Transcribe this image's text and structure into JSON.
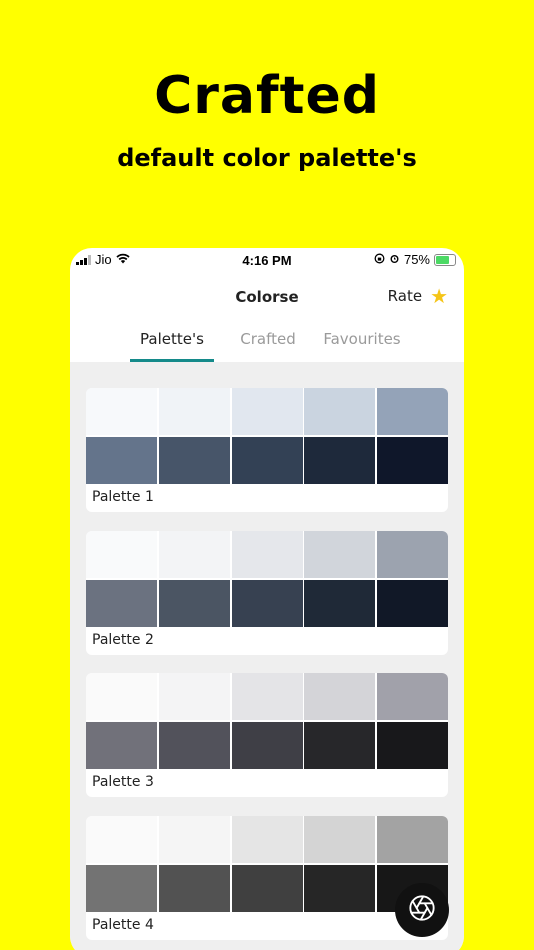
{
  "hero": {
    "title": "Crafted",
    "subtitle": "default color palette's"
  },
  "statusbar": {
    "carrier": "Jio",
    "time": "4:16 PM",
    "battery": "75%"
  },
  "appbar": {
    "title": "Colorse",
    "rate_label": "Rate",
    "rate_icon": "star-icon"
  },
  "tabs": [
    {
      "label": "Palette's",
      "active": true
    },
    {
      "label": "Crafted",
      "active": false
    },
    {
      "label": "Favourites",
      "active": false
    }
  ],
  "palettes": [
    {
      "label": "Palette 1",
      "colors": [
        "#F7F9FB",
        "#F0F3F7",
        "#E1E7EF",
        "#CAD4E0",
        "#94A3B8",
        "#64748B",
        "#475569",
        "#334155",
        "#1E293B",
        "#0F172A"
      ]
    },
    {
      "label": "Palette 2",
      "colors": [
        "#F9FAFB",
        "#F3F4F6",
        "#E5E7EB",
        "#D1D5DB",
        "#9CA3AF",
        "#6B7280",
        "#4B5563",
        "#374151",
        "#1F2937",
        "#111827"
      ]
    },
    {
      "label": "Palette 3",
      "colors": [
        "#FAFAFA",
        "#F4F4F5",
        "#E4E4E7",
        "#D4D4D8",
        "#A1A1AA",
        "#71717A",
        "#52525B",
        "#3F3F46",
        "#27272A",
        "#18181B"
      ]
    },
    {
      "label": "Palette 4",
      "colors": [
        "#FAFAFA",
        "#F5F5F5",
        "#E5E5E5",
        "#D4D4D4",
        "#A3A3A3",
        "#737373",
        "#525252",
        "#404040",
        "#262626",
        "#171717"
      ]
    }
  ],
  "fab": {
    "icon": "aperture-icon"
  },
  "colors": {
    "background": "#FFFF00",
    "tab_indicator": "#148A8A",
    "star": "#F5C518"
  }
}
